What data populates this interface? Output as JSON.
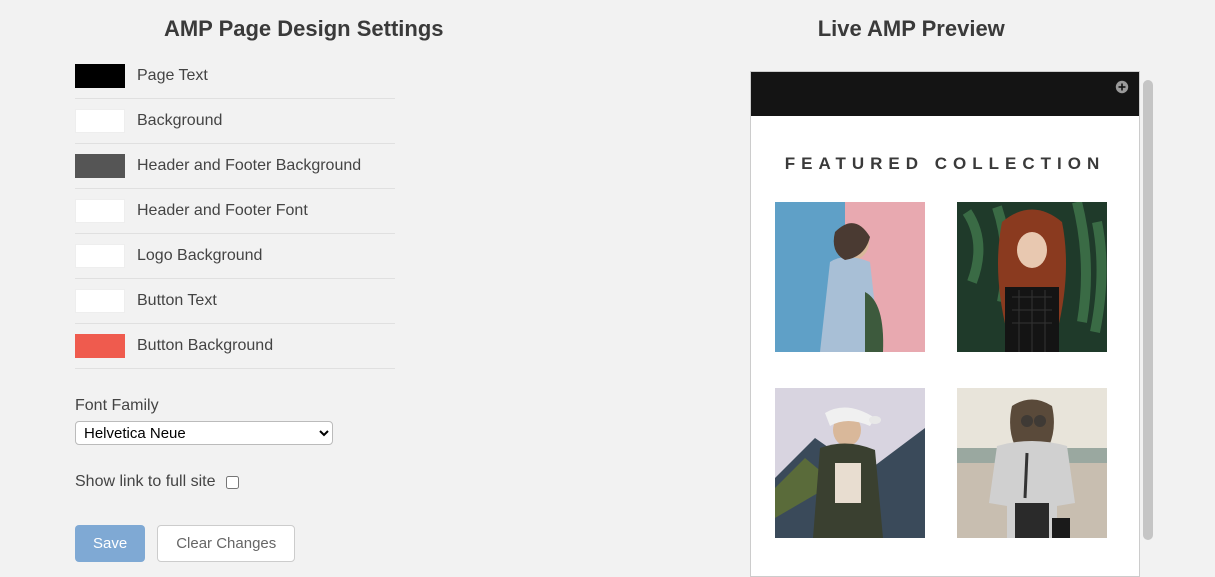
{
  "left": {
    "title": "AMP Page Design Settings",
    "settings": [
      {
        "label": "Page Text",
        "color": "#000000"
      },
      {
        "label": "Background",
        "color": "#ffffff"
      },
      {
        "label": "Header and Footer Background",
        "color": "#555555"
      },
      {
        "label": "Header and Footer Font",
        "color": "#ffffff"
      },
      {
        "label": "Logo Background",
        "color": "#ffffff"
      },
      {
        "label": "Button Text",
        "color": "#ffffff"
      },
      {
        "label": "Button Background",
        "color": "#ef5b4e"
      }
    ],
    "font_family_label": "Font Family",
    "font_family_value": "Helvetica Neue",
    "show_full_site_label": "Show link to full site",
    "show_full_site_checked": false,
    "save_label": "Save",
    "clear_label": "Clear Changes"
  },
  "right": {
    "title": "Live AMP Preview",
    "heading": "FEATURED COLLECTION",
    "products": [
      {
        "name": "product-image-1"
      },
      {
        "name": "product-image-2"
      },
      {
        "name": "product-image-3"
      },
      {
        "name": "product-image-4"
      }
    ]
  }
}
